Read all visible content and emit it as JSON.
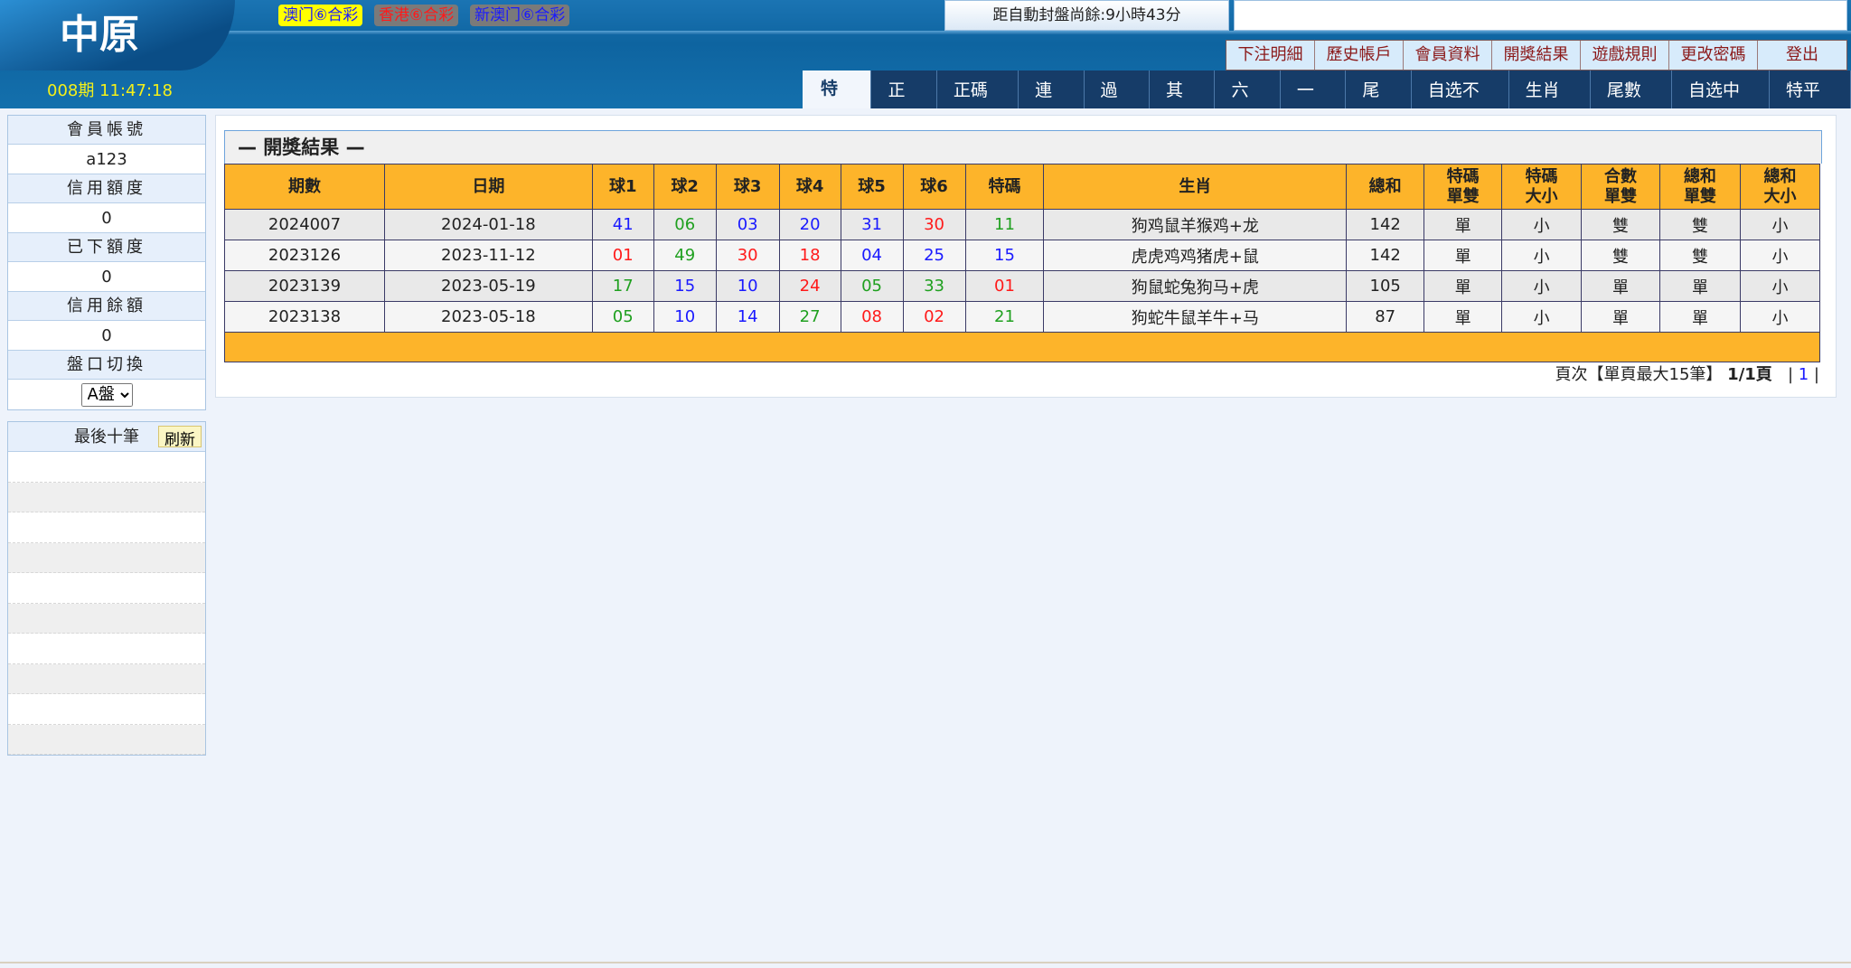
{
  "header": {
    "logo": "中原",
    "lotteries": [
      {
        "label": "澳门⑥合彩",
        "bg": "#ffff00",
        "color": "#1a1aff",
        "active": true
      },
      {
        "label": "香港⑥合彩",
        "bg": "#7a7a7a",
        "color": "#ff1a1a"
      },
      {
        "label": "新澳门⑥合彩",
        "bg": "#7a7a7a",
        "color": "#1a1aff"
      }
    ],
    "countdown": "距自動封盤尚餘:9小時43分",
    "period_time": "008期 11:47:18",
    "top_menu": [
      "下注明細",
      "歷史帳戶",
      "會員資料",
      "開獎結果",
      "遊戲規則",
      "更改密碼",
      "登出"
    ],
    "tabs": [
      "特碼",
      "正碼",
      "正碼特",
      "連碼",
      "過關",
      "其他",
      "六肖",
      "一肖",
      "尾数",
      "自选不中",
      "生肖連",
      "尾數連",
      "自选中一",
      "特平中"
    ],
    "active_tab": "特碼"
  },
  "sidebar": {
    "account_label": "會員帳號",
    "account": "a123",
    "credit_label": "信用額度",
    "credit": "0",
    "used_label": "已下額度",
    "used": "0",
    "balance_label": "信用餘額",
    "balance": "0",
    "plate_label": "盤口切換",
    "plate": "A盤",
    "last_ten_label": "最後十筆",
    "refresh": "刷新"
  },
  "results": {
    "title": "— 開獎結果 —",
    "columns": [
      "期數",
      "日期",
      "球1",
      "球2",
      "球3",
      "球4",
      "球5",
      "球6",
      "特碼",
      "生肖",
      "總和",
      "特碼\n單雙",
      "特碼\n大小",
      "合數\n單雙",
      "總和\n單雙",
      "總和\n大小"
    ],
    "rows": [
      {
        "period": "2024007",
        "date": "2024-01-18",
        "balls": [
          [
            "41",
            "blue"
          ],
          [
            "06",
            "green"
          ],
          [
            "03",
            "blue"
          ],
          [
            "20",
            "blue"
          ],
          [
            "31",
            "blue"
          ],
          [
            "30",
            "red"
          ],
          [
            "11",
            "green"
          ]
        ],
        "zodiac": "狗鸡鼠羊猴鸡+龙",
        "sum": "142",
        "te_oe": "單",
        "te_bs": "小",
        "he_oe": "雙",
        "sum_oe": "雙",
        "sum_bs": "小"
      },
      {
        "period": "2023126",
        "date": "2023-11-12",
        "balls": [
          [
            "01",
            "red"
          ],
          [
            "49",
            "green"
          ],
          [
            "30",
            "red"
          ],
          [
            "18",
            "red"
          ],
          [
            "04",
            "blue"
          ],
          [
            "25",
            "blue"
          ],
          [
            "15",
            "blue"
          ]
        ],
        "zodiac": "虎虎鸡鸡猪虎+鼠",
        "sum": "142",
        "te_oe": "單",
        "te_bs": "小",
        "he_oe": "雙",
        "sum_oe": "雙",
        "sum_bs": "小"
      },
      {
        "period": "2023139",
        "date": "2023-05-19",
        "balls": [
          [
            "17",
            "green"
          ],
          [
            "15",
            "blue"
          ],
          [
            "10",
            "blue"
          ],
          [
            "24",
            "red"
          ],
          [
            "05",
            "green"
          ],
          [
            "33",
            "green"
          ],
          [
            "01",
            "red"
          ]
        ],
        "zodiac": "狗鼠蛇兔狗马+虎",
        "sum": "105",
        "te_oe": "單",
        "te_bs": "小",
        "he_oe": "單",
        "sum_oe": "單",
        "sum_bs": "小"
      },
      {
        "period": "2023138",
        "date": "2023-05-18",
        "balls": [
          [
            "05",
            "green"
          ],
          [
            "10",
            "blue"
          ],
          [
            "14",
            "blue"
          ],
          [
            "27",
            "green"
          ],
          [
            "08",
            "red"
          ],
          [
            "02",
            "red"
          ],
          [
            "21",
            "green"
          ]
        ],
        "zodiac": "狗蛇牛鼠羊牛+马",
        "sum": "87",
        "te_oe": "單",
        "te_bs": "小",
        "he_oe": "單",
        "sum_oe": "單",
        "sum_bs": "小"
      }
    ],
    "pager": {
      "text": "頁次【單頁最大15筆】",
      "pages": "1/1頁",
      "current": "1"
    }
  },
  "colors": {
    "header_orange": "#fdb42a",
    "blue": "#1a1aff",
    "green": "#1fa01f",
    "red": "#ff1a1a"
  }
}
